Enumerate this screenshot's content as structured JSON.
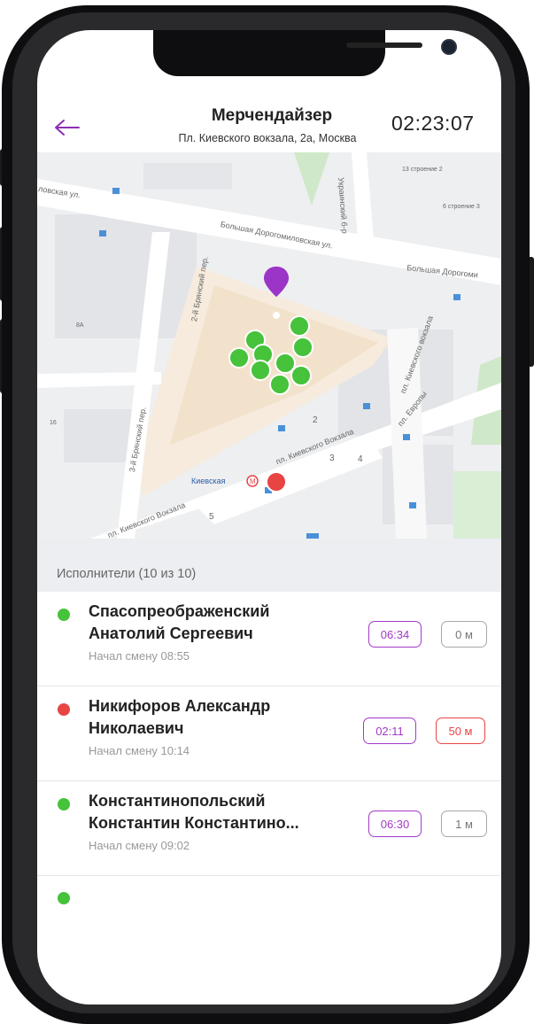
{
  "header": {
    "title": "Мерчендайзер",
    "address": "Пл. Киевского вокзала, 2а, Москва",
    "timer": "02:23:07"
  },
  "map": {
    "streets": {
      "s1": "ловская ул.",
      "s2": "Большая Дорогомиловская ул.",
      "s3": "Большая Дорогоми",
      "s4": "2-й Брянский пер.",
      "s5": "3-й Брянский пер.",
      "s6": "пл. Киевского Вокзала",
      "s7": "пл. Киевского Вокзала",
      "s8": "пл. Европы",
      "s9": "Украинский б-р",
      "s10": "пл. Киевского вокзала",
      "s11": "Киевская"
    },
    "house_numbers": {
      "h1": "2",
      "h2": "3",
      "h3": "4",
      "h4": "5",
      "h5": "13 строение 2",
      "h6": "6 строение 3",
      "h7": "8А",
      "h8": "16"
    },
    "pin_colors": {
      "active": "#46c23b",
      "alert": "#e84444",
      "location": "#9b35c8"
    }
  },
  "list": {
    "header": "Исполнители (10 из 10)",
    "items": [
      {
        "name_line1": "Спасопреображенский",
        "name_line2": "Анатолий Сергеевич",
        "shift": "Начал смену 08:55",
        "time": "06:34",
        "distance": "0 м",
        "status": "active"
      },
      {
        "name_line1": "Никифоров Александр",
        "name_line2": "Николаевич",
        "shift": "Начал смену 10:14",
        "time": "02:11",
        "distance": "50 м",
        "status": "alert"
      },
      {
        "name_line1": "Константинопольский",
        "name_line2": "Константин Константино...",
        "shift": "Начал смену 09:02",
        "time": "06:30",
        "distance": "1 м",
        "status": "active"
      }
    ]
  },
  "colors": {
    "accent": "#a339c8",
    "active": "#46c23b",
    "alert": "#e84444"
  }
}
